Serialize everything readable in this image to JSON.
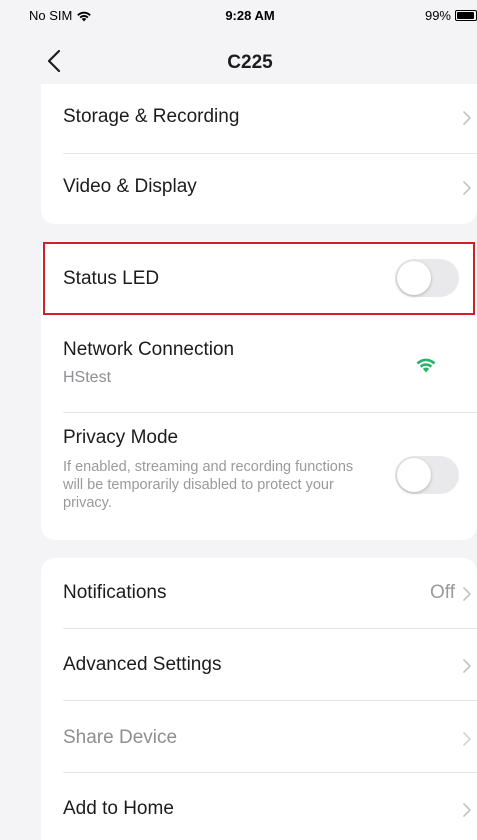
{
  "status_bar": {
    "carrier": "No SIM",
    "time": "9:28 AM",
    "battery_percent": "99%",
    "battery_level": 0.99
  },
  "nav": {
    "title": "C225",
    "back_icon": "chevron-left-icon"
  },
  "group1": {
    "items": [
      {
        "label": "Storage & Recording"
      },
      {
        "label": "Video & Display"
      }
    ]
  },
  "group2": {
    "status_led": {
      "label": "Status LED",
      "enabled": false
    },
    "network": {
      "label": "Network Connection",
      "ssid": "HStest",
      "icon": "wifi-icon",
      "icon_color": "#2bb36b"
    },
    "privacy": {
      "label": "Privacy Mode",
      "description": "If enabled, streaming and recording functions will be temporarily disabled to protect your privacy.",
      "enabled": false
    }
  },
  "group3": {
    "notifications": {
      "label": "Notifications",
      "value": "Off"
    },
    "advanced": {
      "label": "Advanced Settings"
    },
    "share": {
      "label": "Share Device"
    },
    "add_home": {
      "label": "Add to Home"
    }
  },
  "colors": {
    "highlight": "#d0202a",
    "background": "#f4f4f6",
    "toggle_off": "#e9e9ec"
  }
}
